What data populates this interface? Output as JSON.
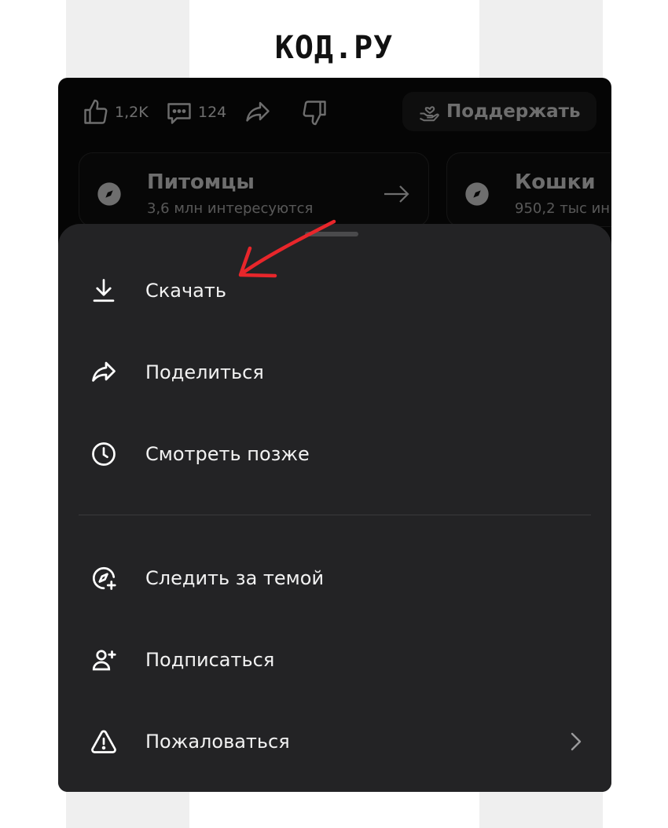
{
  "logo": {
    "text": "КОД.РУ"
  },
  "actions": {
    "like_count": "1,2K",
    "comment_count": "124",
    "support_label": "Поддержать"
  },
  "topics": [
    {
      "name": "Питомцы",
      "subtitle": "3,6 млн интересуются"
    },
    {
      "name": "Кошки",
      "subtitle": "950,2 тыс ин"
    }
  ],
  "menu": {
    "items": [
      {
        "label": "Скачать",
        "icon": "download-icon"
      },
      {
        "label": "Поделиться",
        "icon": "share-icon"
      },
      {
        "label": "Смотреть позже",
        "icon": "clock-icon"
      },
      {
        "label": "Следить за темой",
        "icon": "compass-plus-icon"
      },
      {
        "label": "Подписаться",
        "icon": "user-plus-icon"
      },
      {
        "label": "Пожаловаться",
        "icon": "warning-icon"
      }
    ]
  },
  "colors": {
    "sheet_bg": "#232325",
    "annotation_arrow": "#e8262b"
  }
}
